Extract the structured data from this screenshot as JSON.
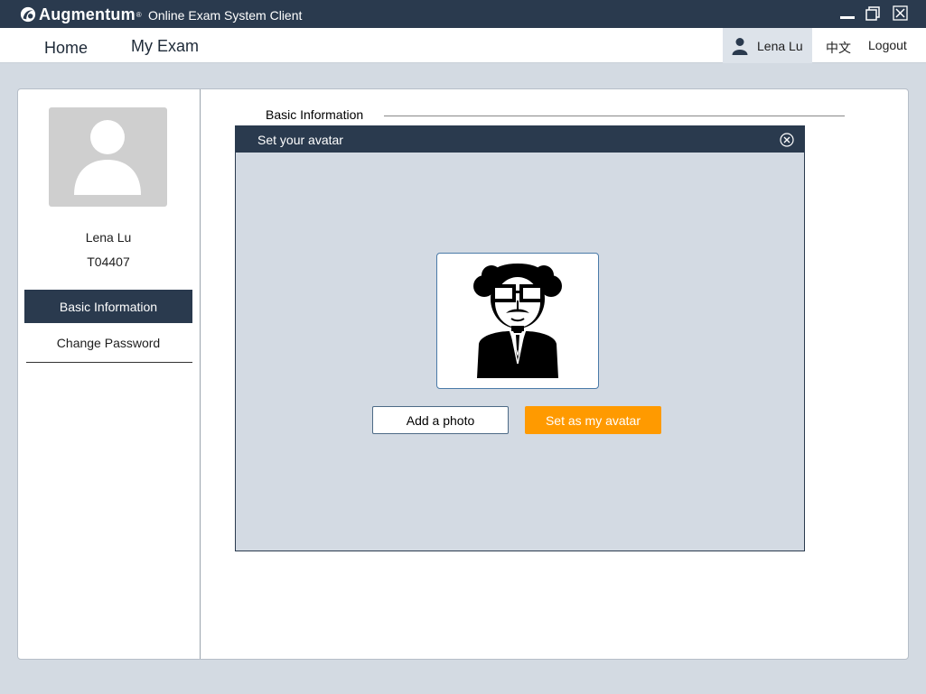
{
  "titlebar": {
    "brand": "Augmentum",
    "brand_mark": "®",
    "app_title": "Online Exam System Client",
    "icons": [
      "augmentum-logo-icon",
      "minimize-icon",
      "maximize-icon",
      "close-icon"
    ]
  },
  "nav": {
    "home": "Home",
    "my_exam": "My Exam",
    "user_name": "Lena Lu",
    "language": "中文",
    "logout": "Logout"
  },
  "sidebar": {
    "name": "Lena Lu",
    "id": "T04407",
    "items": [
      {
        "label": "Basic Information",
        "active": true
      },
      {
        "label": "Change Password",
        "active": false
      }
    ]
  },
  "main": {
    "section_title": "Basic Information"
  },
  "dialog": {
    "title": "Set  your avatar",
    "add_photo": "Add a photo",
    "set_avatar": "Set as my avatar"
  },
  "colors": {
    "dark_navy": "#2a3a4e",
    "accent_orange": "#ff9a00",
    "background": "#d3dae2",
    "active_user_bg": "#dde3ea"
  }
}
